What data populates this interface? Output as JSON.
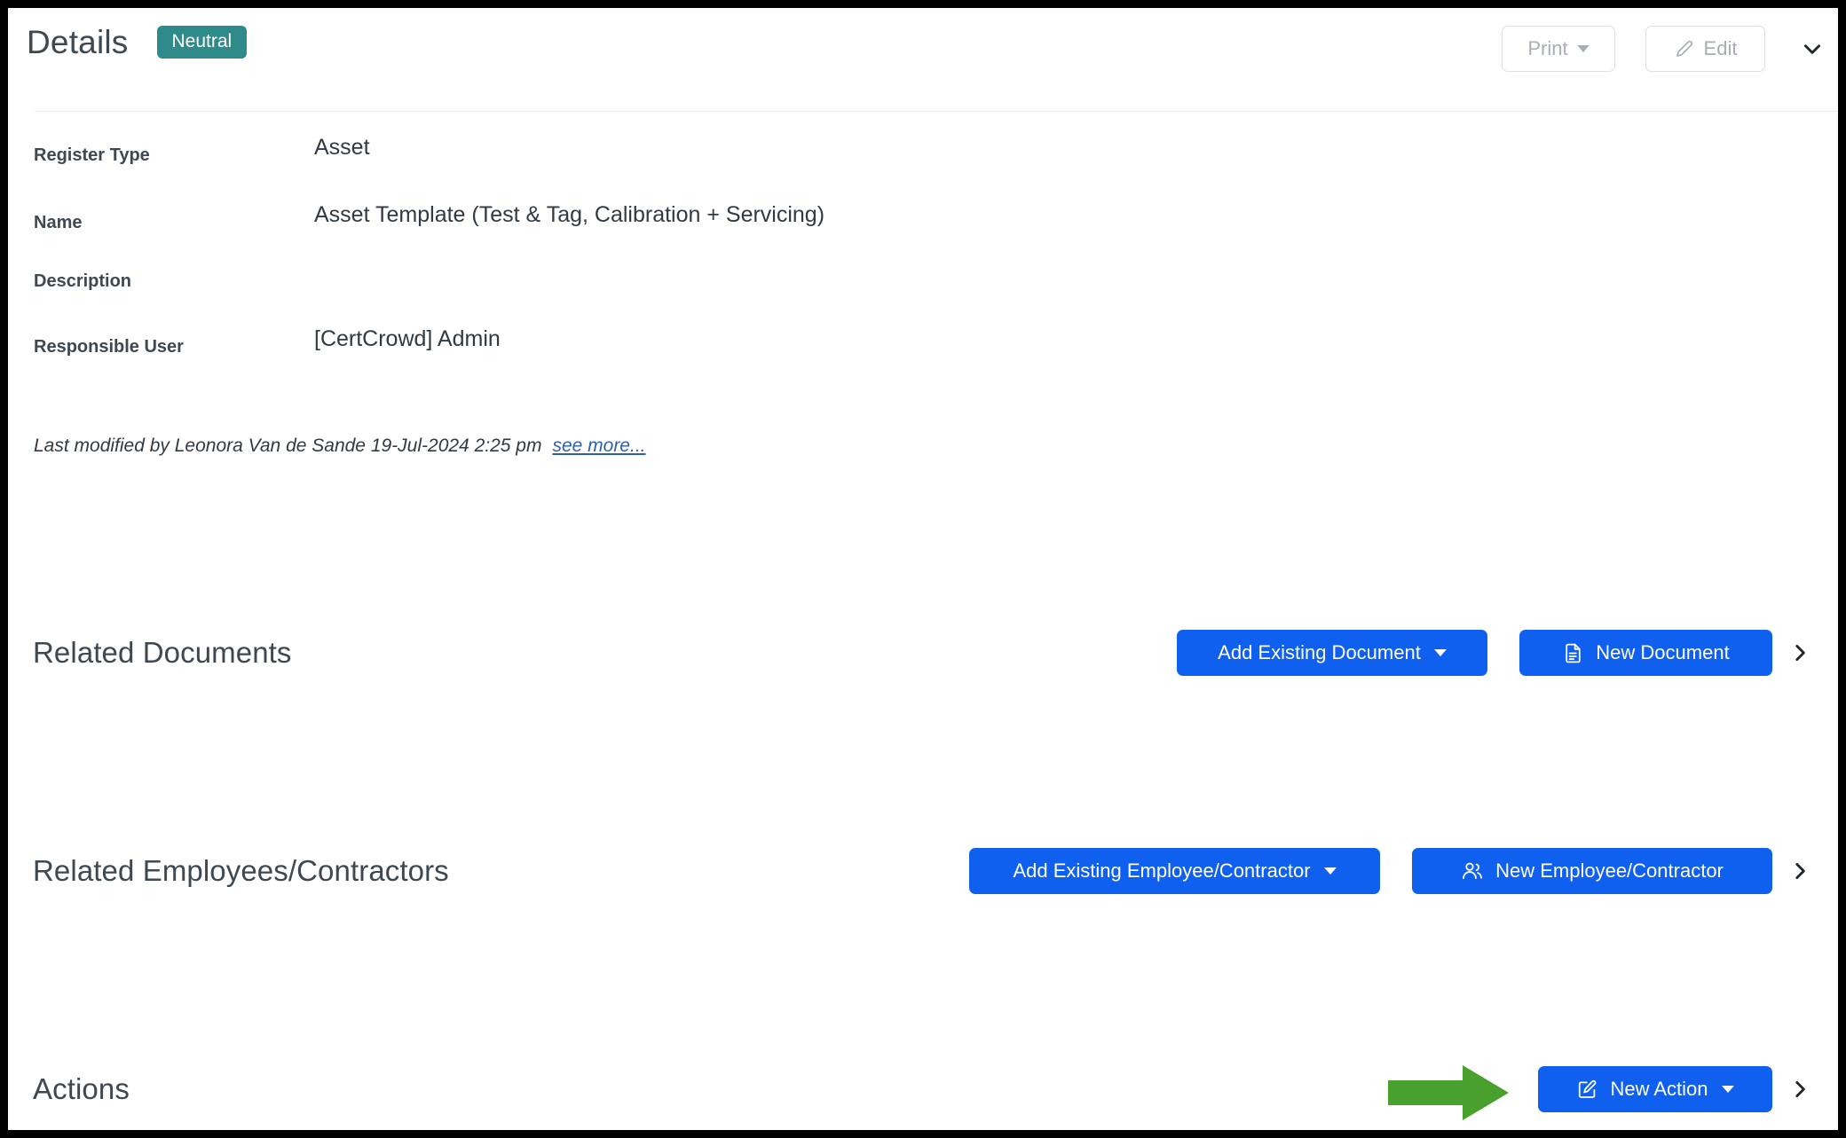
{
  "header": {
    "title": "Details",
    "status_badge": "Neutral",
    "print_label": "Print",
    "edit_label": "Edit",
    "collapse_icon": "chevron-down-icon",
    "badge_color": "#2f8a8a"
  },
  "details": {
    "fields": [
      {
        "label": "Register Type",
        "value": "Asset"
      },
      {
        "label": "Name",
        "value": "Asset Template (Test & Tag, Calibration + Servicing)"
      },
      {
        "label": "Description",
        "value": ""
      },
      {
        "label": "Responsible User",
        "value": "[CertCrowd] Admin"
      }
    ],
    "last_modified": "Last modified by Leonora Van de Sande 19-Jul-2024 2:25 pm",
    "see_more": "see more..."
  },
  "sections": [
    {
      "title": "Related Documents",
      "add_existing_label": "Add Existing Document",
      "new_label": "New Document",
      "new_icon": "document-icon",
      "expand_icon": "chevron-right-icon"
    },
    {
      "title": "Related Employees/Contractors",
      "add_existing_label": "Add Existing Employee/Contractor",
      "new_label": "New Employee/Contractor",
      "new_icon": "users-icon",
      "expand_icon": "chevron-right-icon"
    },
    {
      "title": "Actions",
      "new_label": "New Action",
      "new_icon": "pencil-square-icon",
      "expand_icon": "chevron-right-icon"
    }
  ],
  "annotation": {
    "arrow_color": "#4aa02c",
    "points_to": "New Action"
  },
  "theme": {
    "primary_button": "#1060f0",
    "heading_text": "#3d4852",
    "link_text": "#2f5fa8"
  }
}
